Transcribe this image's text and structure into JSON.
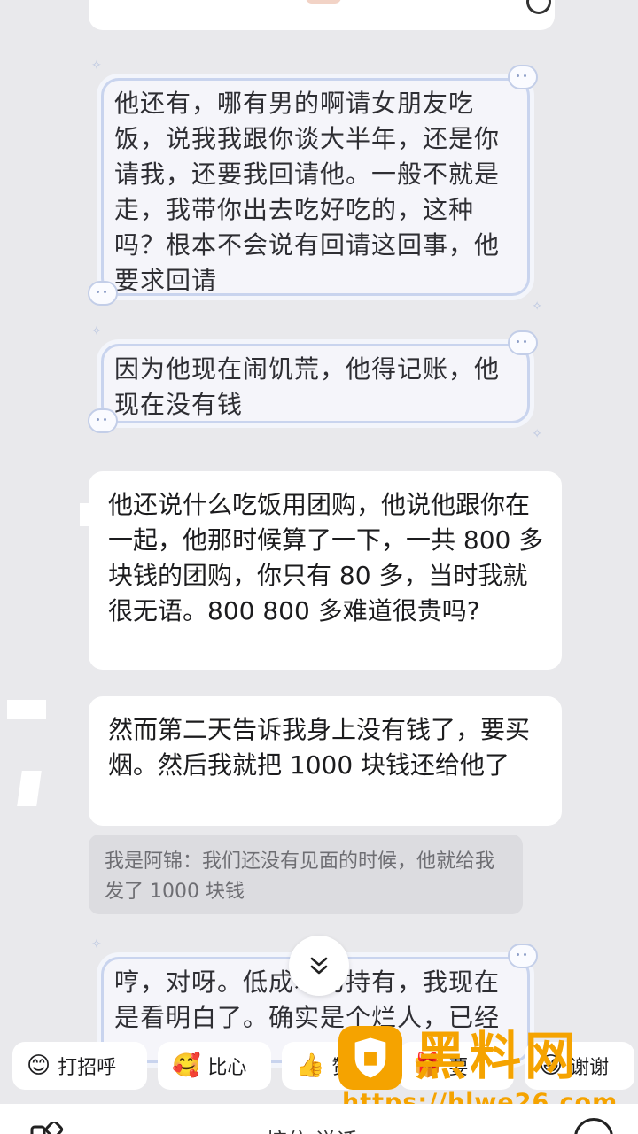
{
  "messages": {
    "m1": "他还有，哪有男的啊请女朋友吃饭，说我我跟你谈大半年，还是你请我，还要我回请他。一般不就是走，我带你出去吃好吃的，这种吗？根本不会说有回请这回事，他要求回请",
    "m2": "因为他现在闹饥荒，他得记账，他现在没有钱",
    "m3": "他还说什么吃饭用团购，他说他跟你在一起，他那时候算了一下，一共 800 多块钱的团购，你只有 80 多，当时我就很无语。800 800 多难道很贵吗?",
    "m4": "然而第二天告诉我身上没有钱了，要买烟。然后我就把 1000 块钱还给他了",
    "quote": "我是阿锦：我们还没有见面的时候，他就给我发了 1000 块钱",
    "m5": "哼，对呀。低成本的持有，我现在是看明白了。确实是个烂人，已经"
  },
  "quick_replies": [
    {
      "label": "打招呼",
      "icon": "smile-emoji-icon",
      "emoji": "😊"
    },
    {
      "label": "比心",
      "icon": "heart-emoji-icon",
      "emoji": "🥰"
    },
    {
      "label": "赞",
      "icon": "thumbs-up-icon",
      "emoji": "👍"
    },
    {
      "label": "要",
      "icon": "gift-icon",
      "emoji": "🎁"
    },
    {
      "label": "谢谢",
      "icon": "laugh-emoji-icon",
      "emoji": "😄"
    }
  ],
  "watermark": {
    "brand": "黑料网",
    "url": "https://hlwe26.com",
    "color": "#f5a300"
  },
  "input": {
    "placeholder": "按住 说话"
  }
}
